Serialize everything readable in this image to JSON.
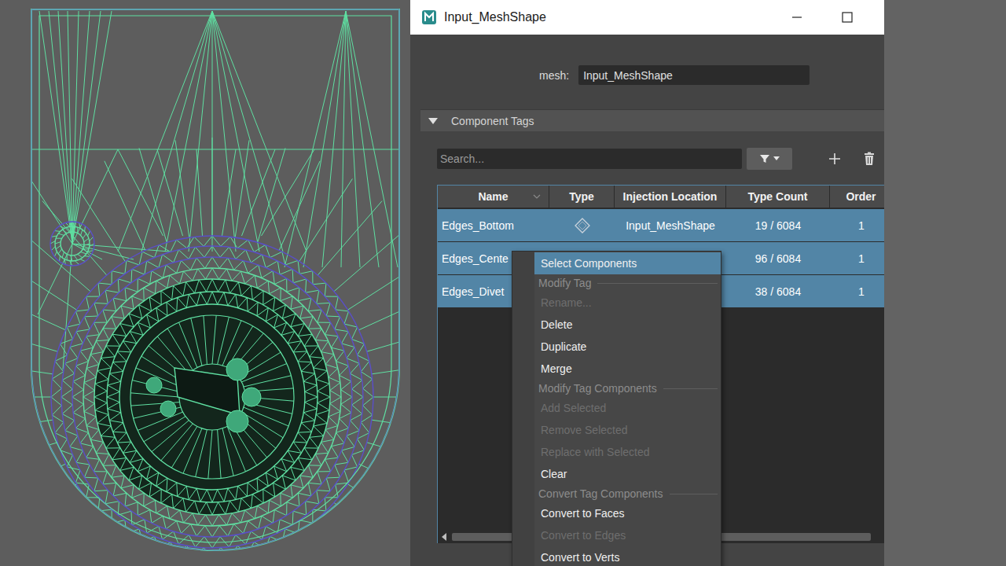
{
  "window": {
    "title": "Input_MeshShape"
  },
  "mesh_field": {
    "label": "mesh:",
    "value": "Input_MeshShape"
  },
  "section": {
    "title": "Component Tags",
    "expanded": true
  },
  "search": {
    "placeholder": "Search..."
  },
  "table": {
    "columns": [
      {
        "label": "Name",
        "sorted": true
      },
      {
        "label": "Type",
        "sorted": false
      },
      {
        "label": "Injection Location",
        "sorted": false
      },
      {
        "label": "Type Count",
        "sorted": false
      },
      {
        "label": "Order",
        "sorted": false
      }
    ],
    "rows": [
      {
        "name": "Edges_Bottom",
        "injection_location": "Input_MeshShape",
        "type_count": "19 / 6084",
        "order": "1",
        "selected": true
      },
      {
        "name": "Edges_Cente",
        "injection_location": "",
        "type_count": "96 / 6084",
        "order": "1",
        "selected": true
      },
      {
        "name": "Edges_Divet",
        "injection_location": "",
        "type_count": "38 / 6084",
        "order": "1",
        "selected": true
      }
    ]
  },
  "context_menu": {
    "items": [
      {
        "label": "Select Components",
        "kind": "item",
        "disabled": false,
        "selected": true
      },
      {
        "label": "Modify Tag",
        "kind": "section",
        "disabled": false,
        "selected": false
      },
      {
        "label": "Rename...",
        "kind": "item",
        "disabled": true,
        "selected": false
      },
      {
        "label": "Delete",
        "kind": "item",
        "disabled": false,
        "selected": false
      },
      {
        "label": "Duplicate",
        "kind": "item",
        "disabled": false,
        "selected": false
      },
      {
        "label": "Merge",
        "kind": "item",
        "disabled": false,
        "selected": false
      },
      {
        "label": "Modify Tag Components",
        "kind": "section",
        "disabled": false,
        "selected": false
      },
      {
        "label": "Add Selected",
        "kind": "item",
        "disabled": true,
        "selected": false
      },
      {
        "label": "Remove Selected",
        "kind": "item",
        "disabled": true,
        "selected": false
      },
      {
        "label": "Replace with Selected",
        "kind": "item",
        "disabled": true,
        "selected": false
      },
      {
        "label": "Clear",
        "kind": "item",
        "disabled": false,
        "selected": false
      },
      {
        "label": "Convert Tag Components",
        "kind": "section",
        "disabled": false,
        "selected": false
      },
      {
        "label": "Convert to Faces",
        "kind": "item",
        "disabled": false,
        "selected": false
      },
      {
        "label": "Convert to Edges",
        "kind": "item",
        "disabled": true,
        "selected": false
      },
      {
        "label": "Convert to Verts",
        "kind": "item",
        "disabled": false,
        "selected": false
      }
    ]
  }
}
